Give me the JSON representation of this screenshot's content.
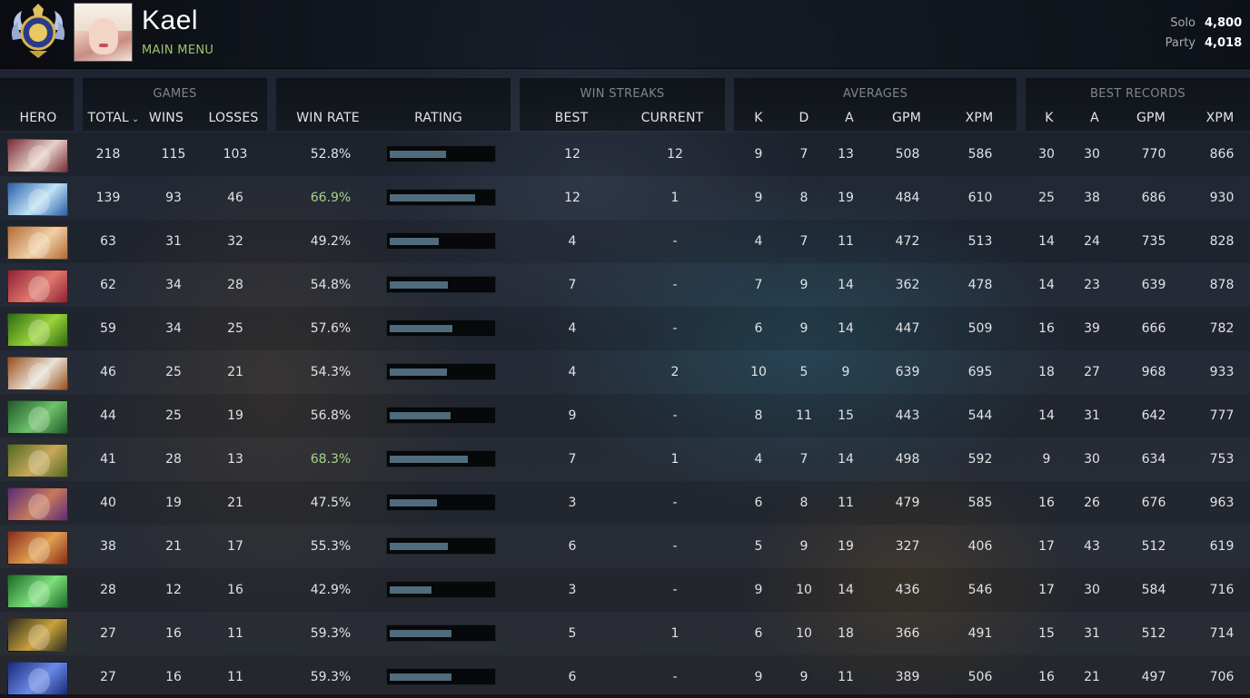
{
  "header": {
    "player_name": "Kael",
    "main_menu_label": "MAIN MENU",
    "mmr": [
      {
        "label": "Solo",
        "value": "4,800"
      },
      {
        "label": "Party",
        "value": "4,018"
      }
    ]
  },
  "groups": {
    "games": "GAMES",
    "win_streaks": "WIN STREAKS",
    "averages": "AVERAGES",
    "best_records": "BEST RECORDS"
  },
  "columns": {
    "hero": "HERO",
    "total": "TOTAL",
    "wins": "WINS",
    "losses": "LOSSES",
    "win_rate": "WIN RATE",
    "rating": "RATING",
    "best": "BEST",
    "current": "CURRENT",
    "avg_k": "K",
    "avg_d": "D",
    "avg_a": "A",
    "avg_gpm": "GPM",
    "avg_xpm": "XPM",
    "rec_k": "K",
    "rec_a": "A",
    "rec_gpm": "GPM",
    "rec_xpm": "XPM"
  },
  "sort_icon": "chevron-down-icon",
  "colors": {
    "accent_green": "#9fc46a",
    "win_rate_good": "#a7d38a",
    "rating_fill": "#4f6b7c"
  },
  "rows": [
    {
      "hero_icon": "hero-portrait-icon",
      "hero_colors": [
        "#7a2a36",
        "#e6d2c8"
      ],
      "total": "218",
      "wins": "115",
      "losses": "103",
      "win_rate": "52.8%",
      "rating": 0.55,
      "good": false,
      "best": "12",
      "current": "12",
      "avg_k": "9",
      "avg_d": "7",
      "avg_a": "13",
      "avg_gpm": "508",
      "avg_xpm": "586",
      "rec_k": "30",
      "rec_a": "30",
      "rec_gpm": "770",
      "rec_xpm": "866"
    },
    {
      "hero_icon": "hero-portrait-icon",
      "hero_colors": [
        "#2a5fa8",
        "#bfe3f5"
      ],
      "total": "139",
      "wins": "93",
      "losses": "46",
      "win_rate": "66.9%",
      "rating": 0.83,
      "good": true,
      "best": "12",
      "current": "1",
      "avg_k": "9",
      "avg_d": "8",
      "avg_a": "19",
      "avg_gpm": "484",
      "avg_xpm": "610",
      "rec_k": "25",
      "rec_a": "38",
      "rec_gpm": "686",
      "rec_xpm": "930"
    },
    {
      "hero_icon": "hero-portrait-icon",
      "hero_colors": [
        "#b56a32",
        "#f0d0a8"
      ],
      "total": "63",
      "wins": "31",
      "losses": "32",
      "win_rate": "49.2%",
      "rating": 0.48,
      "good": false,
      "best": "4",
      "current": "-",
      "avg_k": "4",
      "avg_d": "7",
      "avg_a": "11",
      "avg_gpm": "472",
      "avg_xpm": "513",
      "rec_k": "14",
      "rec_a": "24",
      "rec_gpm": "735",
      "rec_xpm": "828"
    },
    {
      "hero_icon": "hero-portrait-icon",
      "hero_colors": [
        "#8e1f34",
        "#e07a6c"
      ],
      "total": "62",
      "wins": "34",
      "losses": "28",
      "win_rate": "54.8%",
      "rating": 0.57,
      "good": false,
      "best": "7",
      "current": "-",
      "avg_k": "7",
      "avg_d": "9",
      "avg_a": "14",
      "avg_gpm": "362",
      "avg_xpm": "478",
      "rec_k": "14",
      "rec_a": "23",
      "rec_gpm": "639",
      "rec_xpm": "878"
    },
    {
      "hero_icon": "hero-portrait-icon",
      "hero_colors": [
        "#2d6a12",
        "#9bd43a"
      ],
      "total": "59",
      "wins": "34",
      "losses": "25",
      "win_rate": "57.6%",
      "rating": 0.61,
      "good": false,
      "best": "4",
      "current": "-",
      "avg_k": "6",
      "avg_d": "9",
      "avg_a": "14",
      "avg_gpm": "447",
      "avg_xpm": "509",
      "rec_k": "16",
      "rec_a": "39",
      "rec_gpm": "666",
      "rec_xpm": "782"
    },
    {
      "hero_icon": "hero-portrait-icon",
      "hero_colors": [
        "#9a4e1a",
        "#e8e2d8"
      ],
      "total": "46",
      "wins": "25",
      "losses": "21",
      "win_rate": "54.3%",
      "rating": 0.56,
      "good": false,
      "best": "4",
      "current": "2",
      "avg_k": "10",
      "avg_d": "5",
      "avg_a": "9",
      "avg_gpm": "639",
      "avg_xpm": "695",
      "rec_k": "18",
      "rec_a": "27",
      "rec_gpm": "968",
      "rec_xpm": "933"
    },
    {
      "hero_icon": "hero-portrait-icon",
      "hero_colors": [
        "#1f5a2a",
        "#6fc26a"
      ],
      "total": "44",
      "wins": "25",
      "losses": "19",
      "win_rate": "56.8%",
      "rating": 0.59,
      "good": false,
      "best": "9",
      "current": "-",
      "avg_k": "8",
      "avg_d": "11",
      "avg_a": "15",
      "avg_gpm": "443",
      "avg_xpm": "544",
      "rec_k": "14",
      "rec_a": "31",
      "rec_gpm": "642",
      "rec_xpm": "777"
    },
    {
      "hero_icon": "hero-portrait-icon",
      "hero_colors": [
        "#4f6a22",
        "#c9a85a"
      ],
      "total": "41",
      "wins": "28",
      "losses": "13",
      "win_rate": "68.3%",
      "rating": 0.76,
      "good": true,
      "best": "7",
      "current": "1",
      "avg_k": "4",
      "avg_d": "7",
      "avg_a": "14",
      "avg_gpm": "498",
      "avg_xpm": "592",
      "rec_k": "9",
      "rec_a": "30",
      "rec_gpm": "634",
      "rec_xpm": "753"
    },
    {
      "hero_icon": "hero-portrait-icon",
      "hero_colors": [
        "#5a2a7a",
        "#c87a5a"
      ],
      "total": "40",
      "wins": "19",
      "losses": "21",
      "win_rate": "47.5%",
      "rating": 0.46,
      "good": false,
      "best": "3",
      "current": "-",
      "avg_k": "6",
      "avg_d": "8",
      "avg_a": "11",
      "avg_gpm": "479",
      "avg_xpm": "585",
      "rec_k": "16",
      "rec_a": "26",
      "rec_gpm": "676",
      "rec_xpm": "963"
    },
    {
      "hero_icon": "hero-portrait-icon",
      "hero_colors": [
        "#8a2a1a",
        "#e0a050"
      ],
      "total": "38",
      "wins": "21",
      "losses": "17",
      "win_rate": "55.3%",
      "rating": 0.57,
      "good": false,
      "best": "6",
      "current": "-",
      "avg_k": "5",
      "avg_d": "9",
      "avg_a": "19",
      "avg_gpm": "327",
      "avg_xpm": "406",
      "rec_k": "17",
      "rec_a": "43",
      "rec_gpm": "512",
      "rec_xpm": "619"
    },
    {
      "hero_icon": "hero-portrait-icon",
      "hero_colors": [
        "#1a6a2a",
        "#7ee07a"
      ],
      "total": "28",
      "wins": "12",
      "losses": "16",
      "win_rate": "42.9%",
      "rating": 0.41,
      "good": false,
      "best": "3",
      "current": "-",
      "avg_k": "9",
      "avg_d": "10",
      "avg_a": "14",
      "avg_gpm": "436",
      "avg_xpm": "546",
      "rec_k": "17",
      "rec_a": "30",
      "rec_gpm": "584",
      "rec_xpm": "716"
    },
    {
      "hero_icon": "hero-portrait-icon",
      "hero_colors": [
        "#2a2a22",
        "#c9a23a"
      ],
      "total": "27",
      "wins": "16",
      "losses": "11",
      "win_rate": "59.3%",
      "rating": 0.6,
      "good": false,
      "best": "5",
      "current": "1",
      "avg_k": "6",
      "avg_d": "10",
      "avg_a": "18",
      "avg_gpm": "366",
      "avg_xpm": "491",
      "rec_k": "15",
      "rec_a": "31",
      "rec_gpm": "512",
      "rec_xpm": "714"
    },
    {
      "hero_icon": "hero-portrait-icon",
      "hero_colors": [
        "#1a2a7a",
        "#6a8ae8"
      ],
      "total": "27",
      "wins": "16",
      "losses": "11",
      "win_rate": "59.3%",
      "rating": 0.6,
      "good": false,
      "best": "6",
      "current": "-",
      "avg_k": "9",
      "avg_d": "9",
      "avg_a": "11",
      "avg_gpm": "389",
      "avg_xpm": "506",
      "rec_k": "16",
      "rec_a": "21",
      "rec_gpm": "497",
      "rec_xpm": "706"
    }
  ]
}
